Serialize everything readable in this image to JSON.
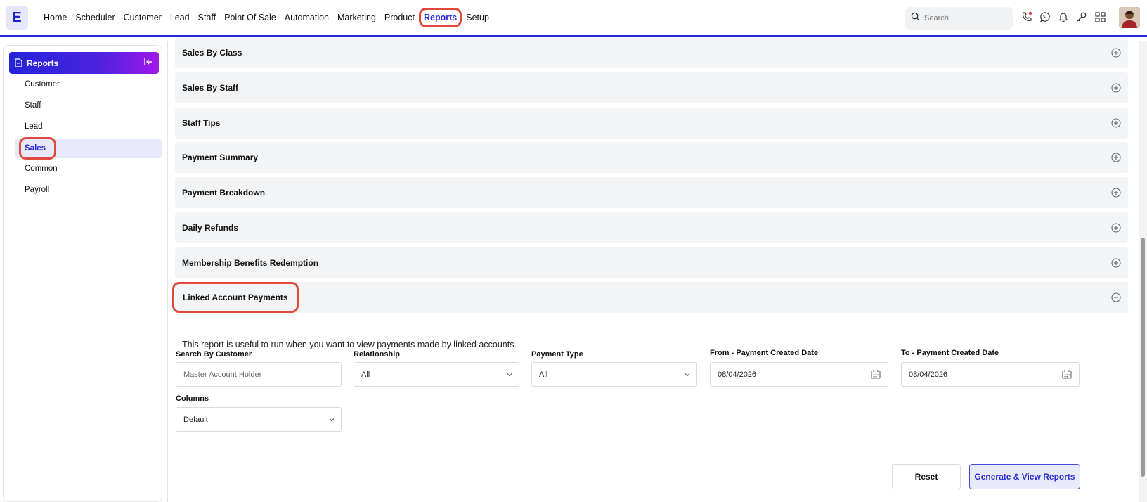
{
  "app": {
    "logo_letter": "E",
    "brand_color": "#2c2cd6",
    "highlight_color": "#e04a3c"
  },
  "nav": {
    "items": [
      "Home",
      "Scheduler",
      "Customer",
      "Lead",
      "Staff",
      "Point Of Sale",
      "Automation",
      "Marketing",
      "Product",
      "Reports",
      "Setup"
    ],
    "active": "Reports"
  },
  "search": {
    "placeholder": "Search"
  },
  "top_icons": [
    "phone-icon",
    "whatsapp-icon",
    "bell-icon",
    "key-icon",
    "apps-grid-icon"
  ],
  "sidebar": {
    "title": "Reports",
    "items": [
      {
        "label": "Customer"
      },
      {
        "label": "Staff"
      },
      {
        "label": "Lead"
      },
      {
        "label": "Sales",
        "active": true
      },
      {
        "label": "Common"
      },
      {
        "label": "Payroll"
      }
    ]
  },
  "reports": [
    {
      "title": "Sales By Class",
      "expanded": false
    },
    {
      "title": "Sales By Staff",
      "expanded": false
    },
    {
      "title": "Staff Tips",
      "expanded": false
    },
    {
      "title": "Payment Summary",
      "expanded": false
    },
    {
      "title": "Payment Breakdown",
      "expanded": false
    },
    {
      "title": "Daily Refunds",
      "expanded": false
    },
    {
      "title": "Membership Benefits Redemption",
      "expanded": false
    },
    {
      "title": "Linked Account Payments",
      "expanded": true
    }
  ],
  "expanded_report": {
    "description": "This report is useful to run when you want to view payments made by linked accounts.",
    "fields": {
      "customer": {
        "label": "Search By Customer",
        "placeholder": "Master Account Holder",
        "value": ""
      },
      "relationship": {
        "label": "Relationship",
        "value": "All"
      },
      "payment_type": {
        "label": "Payment Type",
        "value": "All"
      },
      "from_date": {
        "label": "From - Payment Created Date",
        "value": "08/04/2026"
      },
      "to_date": {
        "label": "To - Payment Created Date",
        "value": "08/04/2026"
      },
      "columns": {
        "label": "Columns",
        "value": "Default"
      }
    },
    "buttons": {
      "reset": "Reset",
      "generate": "Generate & View Reports"
    }
  }
}
